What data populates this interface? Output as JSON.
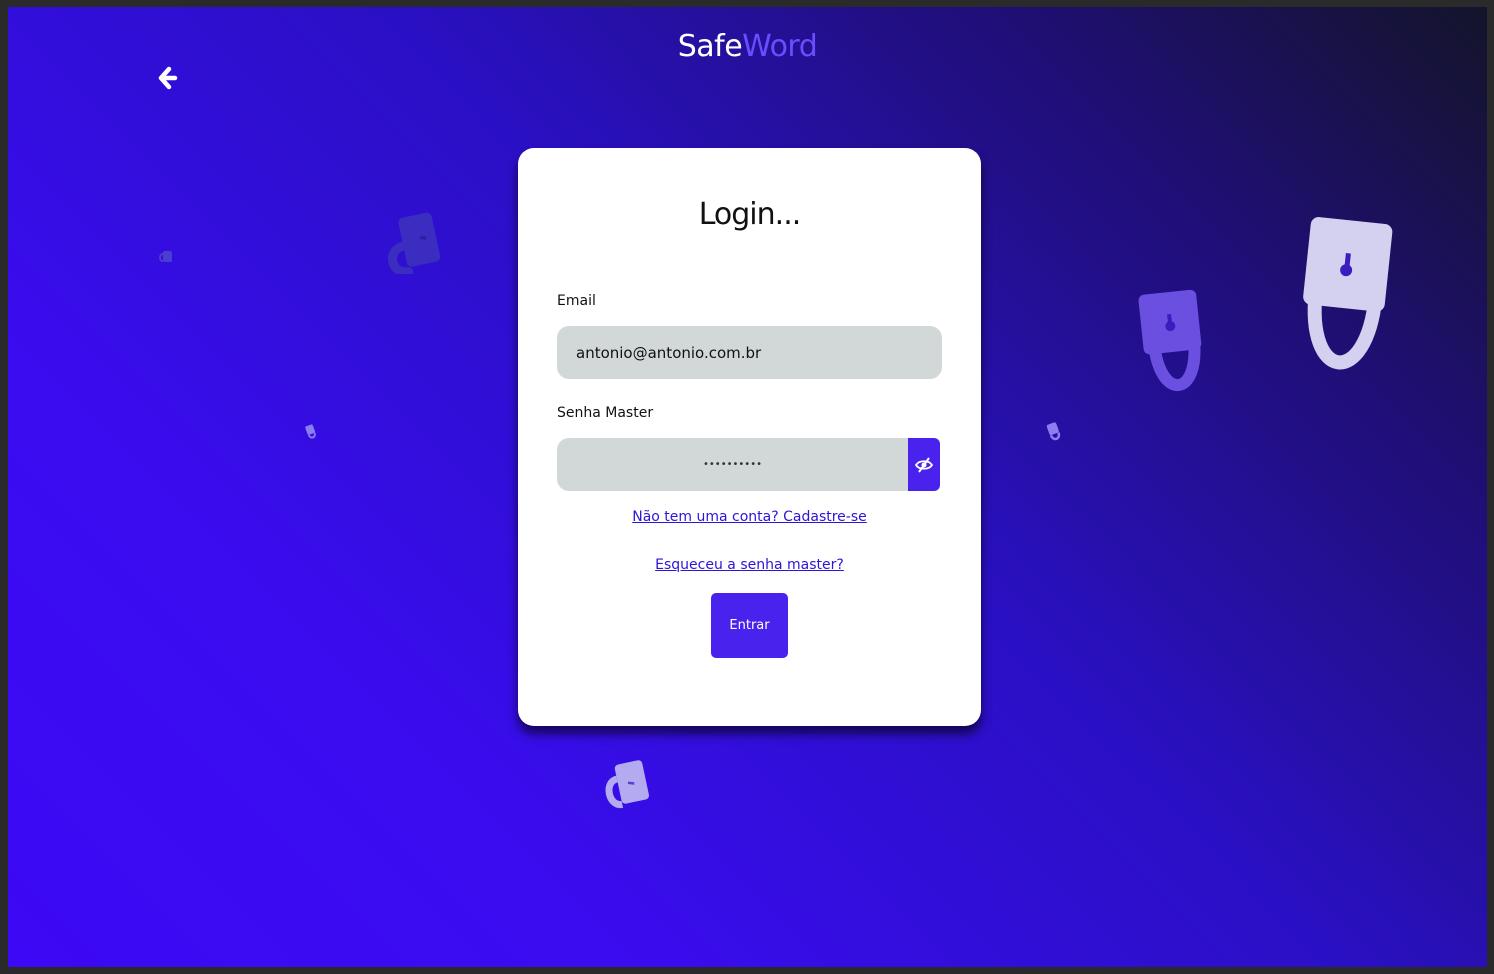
{
  "app": {
    "logo_part1": "Safe",
    "logo_part2": "Word"
  },
  "login": {
    "title": "Login...",
    "email_label": "Email",
    "email_value": "antonio@antonio.com.br",
    "password_label": "Senha Master",
    "password_value": "••••••••••",
    "signup_link": "Não tem uma conta? Cadastre-se",
    "forgot_link": "Esqueceu a senha master?",
    "submit_label": "Entrar"
  },
  "colors": {
    "accent": "#4a22ee",
    "link": "#2a15d8",
    "input_bg": "#d2d8d8"
  },
  "icons": {
    "back": "arrow-left-icon",
    "toggle_password": "eye-off-icon",
    "decoration": "padlock-icon"
  }
}
